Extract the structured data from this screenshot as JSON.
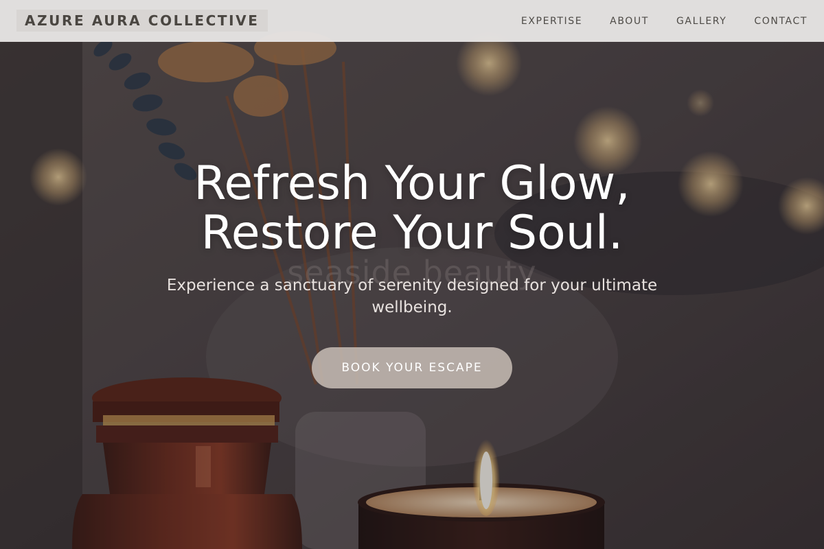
{
  "nav": {
    "brand": "AZURE AURA COLLECTIVE",
    "links": [
      "EXPERTISE",
      "ABOUT",
      "GALLERY",
      "CONTACT"
    ]
  },
  "hero": {
    "headline_line1": "Refresh Your Glow,",
    "headline_line2": "Restore Your Soul.",
    "watermark": "seaside beauty",
    "subtitle": "Experience a sanctuary of serenity designed for your ultimate wellbeing.",
    "cta_label": "BOOK YOUR ESCAPE"
  },
  "colors": {
    "nav_background": "#e9e7e6",
    "brand_text": "#4a4641",
    "cta_background": "#c4bab2",
    "headline_text": "#ffffff"
  }
}
